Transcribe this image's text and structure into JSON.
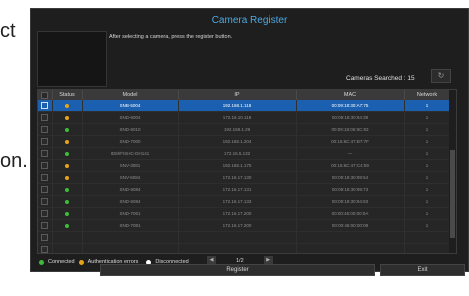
{
  "background_text": [
    "ct",
    "on."
  ],
  "dialog": {
    "title": "Camera Register",
    "instruction": "After selecting a camera, press the register button.",
    "searched": "Cameras Searched : 15",
    "refresh_glyph": "↻"
  },
  "table": {
    "headers": [
      "Status",
      "Model",
      "IP",
      "MAC",
      "Network"
    ],
    "rows": [
      {
        "status": "auth",
        "model": "SNB-5004",
        "ip": "192.168.1.118",
        "mac": "00:09:18:30:A7:75",
        "network": "1",
        "selected": true
      },
      {
        "status": "auth",
        "model": "SND-6004",
        "ip": "172.16.10.119",
        "mac": "00:09:18:30:94:39",
        "network": "1"
      },
      {
        "status": "connected",
        "model": "SND-6010",
        "ip": "192.168.1.29",
        "mac": "00:09:18:05:9C:83",
        "network": "1"
      },
      {
        "status": "auth",
        "model": "SND-7000",
        "ip": "192.168.1.204",
        "mac": "00:16:6C:47:B7:7F",
        "network": "1"
      },
      {
        "status": "connected",
        "model": "IDM/FISHC-DH141",
        "ip": "172.16.5.132",
        "mac": "—",
        "network": "1"
      },
      {
        "status": "auth",
        "model": "SNV-3081",
        "ip": "192.168.1.170",
        "mac": "00:16:6C:47:C4:59",
        "network": "1"
      },
      {
        "status": "auth",
        "model": "SNV-6084",
        "ip": "172.16.17.130",
        "mac": "00:09:18:30:99:54",
        "network": "1"
      },
      {
        "status": "connected",
        "model": "SND-6084",
        "ip": "172.16.17.131",
        "mac": "00:09:18:30:99:73",
        "network": "1"
      },
      {
        "status": "connected",
        "model": "SND-6084",
        "ip": "172.16.17.133",
        "mac": "00:09:18:30:94:83",
        "network": "1"
      },
      {
        "status": "connected",
        "model": "SND-7061",
        "ip": "172.16.17.200",
        "mac": "00:00:46:00:00:0A",
        "network": "1"
      },
      {
        "status": "connected",
        "model": "SND-7081",
        "ip": "172.16.17.200",
        "mac": "00:00:46:00:00:09",
        "network": "1"
      },
      {
        "status": "empty"
      },
      {
        "status": "empty"
      }
    ]
  },
  "legend": {
    "connected": "Connected",
    "auth": "Authentication errors",
    "disconnected": "Disconnected"
  },
  "pager": {
    "text": "1/2",
    "prev": "◀",
    "next": "▶"
  },
  "buttons": {
    "register": "Register",
    "exit": "Exit"
  },
  "colors": {
    "connected": "#3dbb3d",
    "auth": "#e8a317",
    "disconnected": "#ffffff",
    "selected": "#1b5fb0",
    "title": "#4fa8e0"
  }
}
